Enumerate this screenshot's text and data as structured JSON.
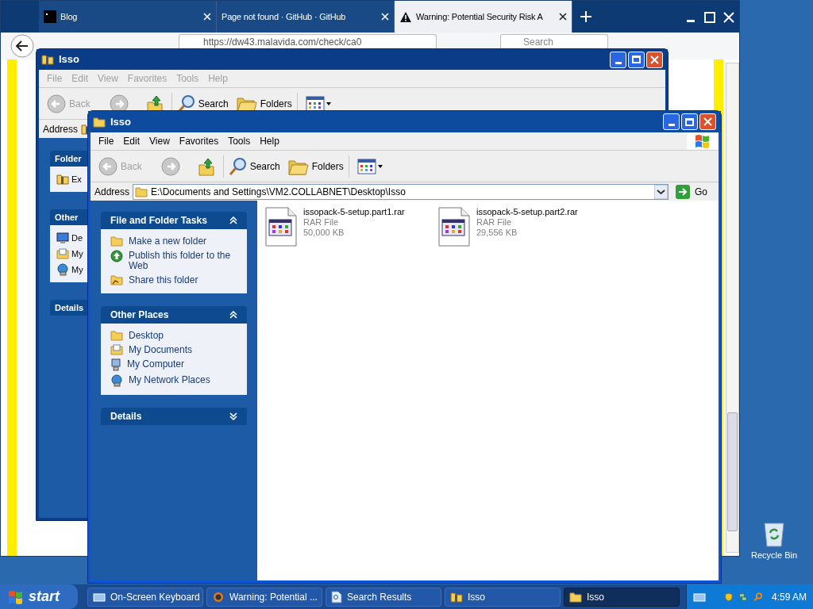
{
  "browser": {
    "tabs": [
      {
        "label": "Blog",
        "kind": "site",
        "selected": false
      },
      {
        "label": "Page not found · GitHub · GitHub",
        "selected": false
      },
      {
        "label": "Warning: Potential Security Risk A",
        "kind": "warning",
        "selected": true
      }
    ],
    "url": "https://dw43.malavida.com/check/ca0",
    "search": {
      "placeholder": "Search"
    }
  },
  "back_window": {
    "title": "Isso",
    "menu": [
      {
        "label": "File",
        "disabled": true
      },
      {
        "label": "Edit",
        "disabled": true
      },
      {
        "label": "View",
        "disabled": true
      },
      {
        "label": "Favorites",
        "disabled": true
      },
      {
        "label": "Tools",
        "disabled": true
      },
      {
        "label": "Help",
        "disabled": true
      }
    ],
    "toolbar": {
      "back": "Back",
      "search": "Search",
      "folders": "Folders"
    },
    "address_label": "Address",
    "panels": [
      {
        "title": "Folder",
        "items": [
          {
            "label": "Ex",
            "kind": "zip"
          }
        ]
      },
      {
        "title": "Other",
        "items": [
          {
            "label": "De",
            "kind": "desktop"
          },
          {
            "label": "My",
            "kind": "documents"
          },
          {
            "label": "My",
            "kind": "network"
          }
        ]
      },
      {
        "title": "Details"
      }
    ]
  },
  "window": {
    "title": "Isso",
    "menu": [
      {
        "label": "File",
        "disabled": false
      },
      {
        "label": "Edit",
        "disabled": false
      },
      {
        "label": "View",
        "disabled": false
      },
      {
        "label": "Favorites",
        "disabled": false
      },
      {
        "label": "Tools",
        "disabled": false
      },
      {
        "label": "Help",
        "disabled": false
      }
    ],
    "toolbar": {
      "back": "Back",
      "search": "Search",
      "folders": "Folders"
    },
    "address": {
      "label": "Address",
      "value": "E:\\Documents and Settings\\VM2.COLLABNET\\Desktop\\Isso",
      "go": "Go"
    },
    "panels": [
      {
        "title": "File and Folder Tasks",
        "expanded": true,
        "items": [
          {
            "label": "Make a new folder",
            "kind": "folder"
          },
          {
            "label": "Publish this folder to the Web",
            "kind": "globe"
          },
          {
            "label": "Share this folder",
            "kind": "share"
          }
        ]
      },
      {
        "title": "Other Places",
        "expanded": true,
        "items": [
          {
            "label": "Desktop",
            "kind": "folder"
          },
          {
            "label": "My Documents",
            "kind": "documents"
          },
          {
            "label": "My Computer",
            "kind": "computer"
          },
          {
            "label": "My Network Places",
            "kind": "network"
          }
        ]
      },
      {
        "title": "Details",
        "expanded": false
      }
    ],
    "files": [
      {
        "name": "issopack-5-setup.part1.rar",
        "type": "RAR File",
        "size": "50,000 KB"
      },
      {
        "name": "issopack-5-setup.part2.rar",
        "type": "RAR File",
        "size": "29,556 KB"
      }
    ]
  },
  "desktop_icons": [
    {
      "label": "Recycle Bin"
    }
  ],
  "taskbar": {
    "start": "start",
    "buttons": [
      {
        "label": "On-Screen Keyboard",
        "kind": "keyboard",
        "selected": false
      },
      {
        "label": "Warning: Potential ...",
        "kind": "browser",
        "selected": false
      },
      {
        "label": "Search Results",
        "kind": "search",
        "selected": false
      },
      {
        "label": "Isso",
        "kind": "zip",
        "selected": false
      },
      {
        "label": "Isso",
        "kind": "folder",
        "selected": true
      }
    ],
    "clock": "4:59 AM"
  }
}
